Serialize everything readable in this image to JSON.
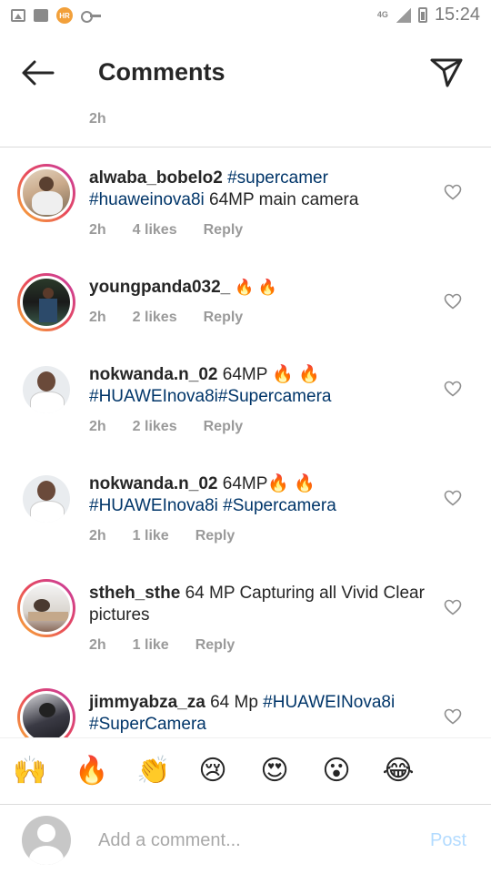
{
  "status_bar": {
    "notification_badge": "HR",
    "network": "4G",
    "time": "15:24"
  },
  "header": {
    "title": "Comments"
  },
  "caption": {
    "time": "2h"
  },
  "comments": [
    {
      "username": "alwaba_bobelo2",
      "text_parts": [
        {
          "text": "#supercamer",
          "type": "tag"
        },
        {
          "text": " ",
          "type": "plain"
        },
        {
          "text": "#huaweinova8i",
          "type": "tag"
        },
        {
          "text": " 64MP main camera",
          "type": "plain"
        }
      ],
      "time": "2h",
      "likes": "4 likes",
      "reply": "Reply",
      "has_story_ring": true
    },
    {
      "username": "youngpanda032_",
      "text_parts": [
        {
          "text": " 🔥 🔥",
          "type": "plain"
        }
      ],
      "time": "2h",
      "likes": "2 likes",
      "reply": "Reply",
      "has_story_ring": true
    },
    {
      "username": "nokwanda.n_02",
      "text_parts": [
        {
          "text": " 64MP 🔥 🔥 ",
          "type": "plain"
        },
        {
          "text": "#HUAWEInova8i#Supercamera",
          "type": "tag"
        }
      ],
      "time": "2h",
      "likes": "2 likes",
      "reply": "Reply",
      "has_story_ring": false
    },
    {
      "username": "nokwanda.n_02",
      "text_parts": [
        {
          "text": " 64MP🔥 🔥 ",
          "type": "plain"
        },
        {
          "text": "#HUAWEInova8i",
          "type": "tag"
        },
        {
          "text": " ",
          "type": "plain"
        },
        {
          "text": "#Supercamera",
          "type": "tag"
        }
      ],
      "time": "2h",
      "likes": "1 like",
      "reply": "Reply",
      "has_story_ring": false
    },
    {
      "username": "stheh_sthe",
      "text_parts": [
        {
          "text": " 64 MP Capturing all Vivid Clear pictures",
          "type": "plain"
        }
      ],
      "time": "2h",
      "likes": "1 like",
      "reply": "Reply",
      "has_story_ring": true
    },
    {
      "username": "jimmyabza_za",
      "text_parts": [
        {
          "text": " 64 Mp ",
          "type": "plain"
        },
        {
          "text": "#HUAWEINova8i",
          "type": "tag"
        },
        {
          "text": " ",
          "type": "plain"
        },
        {
          "text": "#SuperCamera",
          "type": "tag"
        }
      ],
      "time": "",
      "likes": "",
      "reply": "",
      "has_story_ring": true
    }
  ],
  "emoji_bar": [
    "🙌",
    "🔥",
    "👏",
    "😢",
    "😍",
    "😮",
    "😂"
  ],
  "composer": {
    "placeholder": "Add a comment...",
    "post_label": "Post"
  },
  "colors": {
    "hashtag": "#003569",
    "meta_text": "#9a9a9a",
    "post_disabled": "#b3dbff"
  }
}
